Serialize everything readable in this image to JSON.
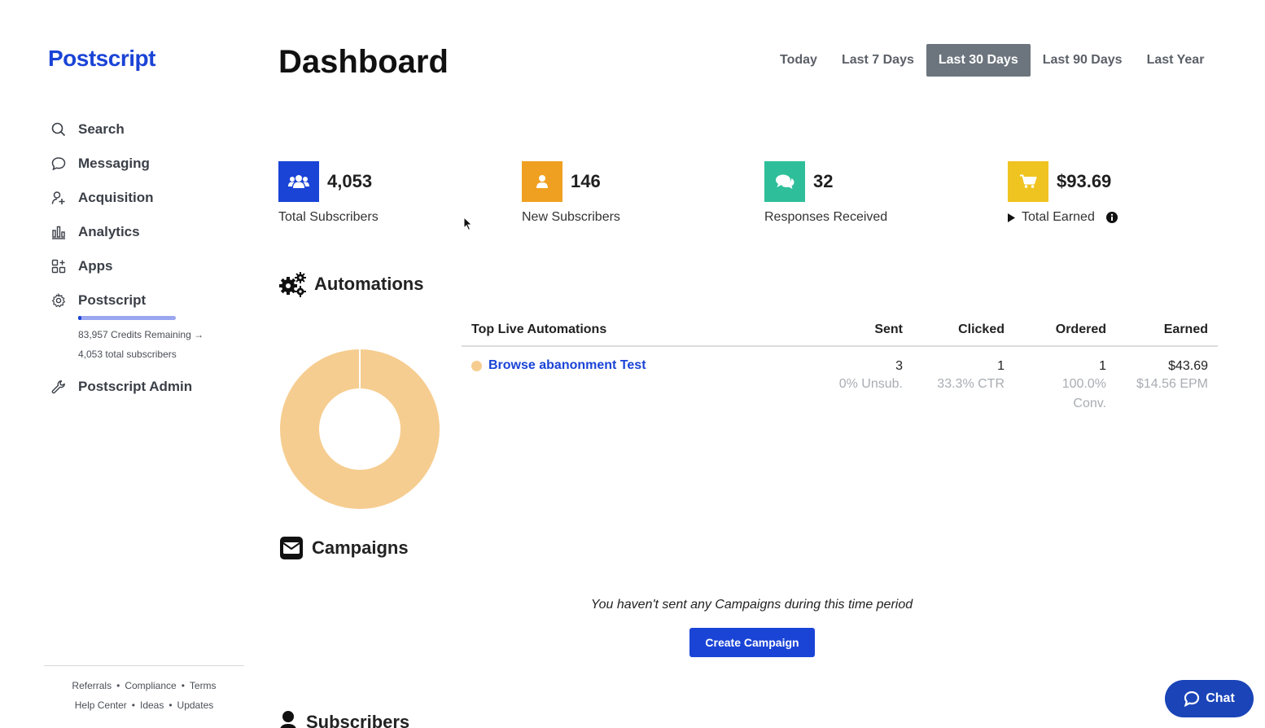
{
  "app": {
    "logo": "Postscript"
  },
  "sidebar": {
    "items": [
      {
        "label": "Search",
        "icon": "search-icon"
      },
      {
        "label": "Messaging",
        "icon": "chat-bubble-icon"
      },
      {
        "label": "Acquisition",
        "icon": "user-plus-icon"
      },
      {
        "label": "Analytics",
        "icon": "bar-chart-icon"
      },
      {
        "label": "Apps",
        "icon": "apps-grid-icon"
      },
      {
        "label": "Postscript",
        "icon": "gear-icon"
      }
    ],
    "credits": {
      "remaining_text": "83,957 Credits Remaining →",
      "subscribers_text": "4,053 total subscribers",
      "fraction_used": 0.03
    },
    "admin": {
      "label": "Postscript Admin",
      "icon": "wrench-icon"
    },
    "footer": {
      "row1": [
        "Referrals",
        "Compliance",
        "Terms"
      ],
      "row2": [
        "Help Center",
        "Ideas",
        "Updates"
      ],
      "separator": "•"
    }
  },
  "header": {
    "title": "Dashboard",
    "ranges": [
      "Today",
      "Last 7 Days",
      "Last 30 Days",
      "Last 90 Days",
      "Last Year"
    ],
    "active_range": "Last 30 Days"
  },
  "stats": [
    {
      "value": "4,053",
      "label": "Total Subscribers",
      "icon": "users-icon",
      "color": "#1a44d6"
    },
    {
      "value": "146",
      "label": "New Subscribers",
      "icon": "user-icon",
      "color": "#f0a020"
    },
    {
      "value": "32",
      "label": "Responses Received",
      "icon": "comments-icon",
      "color": "#2ebf9a"
    },
    {
      "value": "$93.69",
      "label": "Total Earned",
      "icon": "cart-icon",
      "color": "#f0c420"
    }
  ],
  "automations": {
    "title": "Automations",
    "table": {
      "headers": [
        "Top Live Automations",
        "Sent",
        "Clicked",
        "Ordered",
        "Earned"
      ],
      "rows": [
        {
          "name": "Browse abanonment Test",
          "sent": "3",
          "sent_sub": "0% Unsub.",
          "clicked": "1",
          "clicked_sub": "33.3% CTR",
          "ordered": "1",
          "ordered_sub": "100.0%",
          "ordered_sub2": "Conv.",
          "earned": "$43.69",
          "earned_sub": "$14.56 EPM"
        }
      ]
    },
    "donut_color": "#f6cd90"
  },
  "campaigns": {
    "title": "Campaigns",
    "empty_message": "You haven't sent any Campaigns during this time period",
    "create_label": "Create Campaign"
  },
  "subscribers": {
    "title": "Subscribers"
  },
  "chat": {
    "label": "Chat"
  }
}
